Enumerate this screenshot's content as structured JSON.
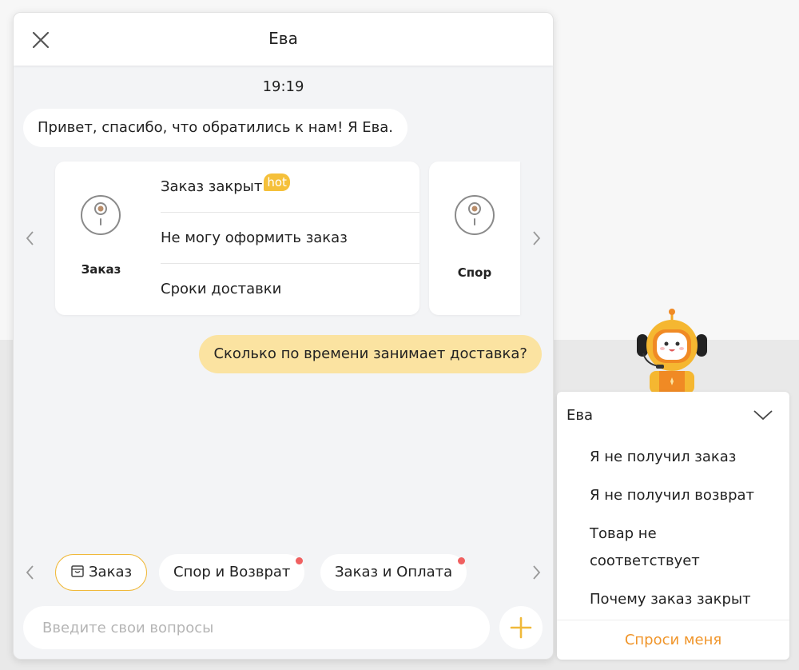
{
  "chat": {
    "title": "Ева",
    "timestamp": "19:19",
    "greeting": "Привет, спасибо, что обратились к нам! Я Ева.",
    "user_message": "Сколько по времени занимает доставка?"
  },
  "faq_cards": [
    {
      "category": "Заказ",
      "icon": "disc-icon",
      "items": [
        {
          "label": "Заказ закрыт",
          "badge": "hot"
        },
        {
          "label": "Не могу оформить заказ",
          "badge": ""
        },
        {
          "label": "Сроки доставки",
          "badge": ""
        }
      ]
    },
    {
      "category": "Спор",
      "icon": "disc-icon"
    }
  ],
  "chips": [
    {
      "label": "Заказ",
      "active": true,
      "dot": false,
      "icon": "bag-icon"
    },
    {
      "label": "Спор и Возврат",
      "active": false,
      "dot": true
    },
    {
      "label": "Заказ и Оплата",
      "active": false,
      "dot": true
    }
  ],
  "input": {
    "placeholder": "Введите свои вопросы"
  },
  "side_panel": {
    "title": "Ева",
    "items": [
      "Я не получил заказ",
      "Я не получил возврат",
      "Товар не соответствует",
      "Почему заказ закрыт"
    ],
    "ask_button": "Спроси меня"
  },
  "colors": {
    "accent": "#f0b93a",
    "user_bubble": "#fbe3a1",
    "ask_text": "#f0952a",
    "notify_dot": "#f06060"
  }
}
